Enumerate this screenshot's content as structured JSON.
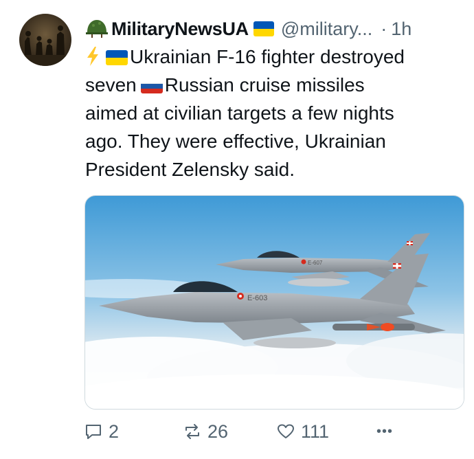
{
  "tweet": {
    "display_name": "MilitaryNewsUA",
    "handle": "@military...",
    "separator": "·",
    "time": "1h",
    "text_lines": [
      "Ukrainian F-16 fighter destroyed",
      "seven",
      "Russian cruise missiles",
      "aimed at civilian targets a few nights",
      "ago. They were effective, Ukrainian",
      "President Zelensky said."
    ],
    "icons": [
      "helmet-icon",
      "ukraine-flag-icon",
      "lightning-icon",
      "russia-flag-icon"
    ],
    "media": {
      "tail_code_front": "E-603",
      "tail_code_back": "E-607"
    }
  },
  "actions": {
    "replies": "2",
    "reposts": "26",
    "likes": "111",
    "more": "•••"
  },
  "colors": {
    "text": "#0f1419",
    "secondary": "#536471",
    "ukraine_blue": "#0057b7",
    "ukraine_yellow": "#ffd700"
  }
}
